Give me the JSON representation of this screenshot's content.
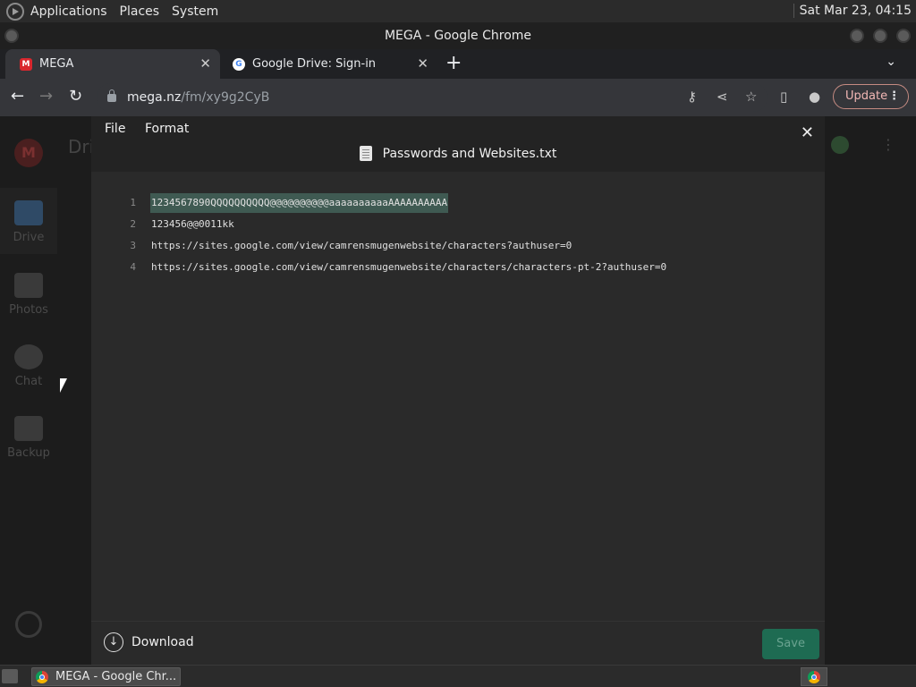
{
  "top_panel": {
    "menus": [
      "Applications",
      "Places",
      "System"
    ],
    "clock": "Sat Mar 23, 04:15"
  },
  "window": {
    "title": "MEGA - Google Chrome"
  },
  "tabs": [
    {
      "label": "MEGA",
      "icon": "mega-favicon",
      "active": true
    },
    {
      "label": "Google Drive: Sign-in",
      "icon": "google-favicon",
      "active": false
    }
  ],
  "toolbar": {
    "url_host": "mega.nz",
    "url_path": "/fm/xy9g2CyB",
    "update_label": "Update"
  },
  "mega_app": {
    "header_fragment": "Dri",
    "sidebar": [
      {
        "label": "Drive",
        "icon": "folder-icon"
      },
      {
        "label": "Photos",
        "icon": "photos-icon"
      },
      {
        "label": "Chat",
        "icon": "chat-icon"
      },
      {
        "label": "Backup",
        "icon": "backup-icon"
      }
    ]
  },
  "editor": {
    "menus": [
      "File",
      "Format"
    ],
    "filename": "Passwords and Websites.txt",
    "lines": [
      {
        "num": "1",
        "text": "1234567890QQQQQQQQQQ@@@@@@@@@@aaaaaaaaaaAAAAAAAAAA",
        "selected": true
      },
      {
        "num": "2",
        "text": "123456@@0011kk",
        "selected": false
      },
      {
        "num": "3",
        "text": "https://sites.google.com/view/camrensmugenwebsite/characters?authuser=0",
        "selected": false
      },
      {
        "num": "4",
        "text": "https://sites.google.com/view/camrensmugenwebsite/characters/characters-pt-2?authuser=0",
        "selected": false
      }
    ],
    "download_label": "Download",
    "save_label": "Save"
  },
  "taskbar": {
    "window_label": "MEGA - Google Chr..."
  },
  "colors": {
    "selection": "#3f5a52",
    "save_button": "#1e6b52",
    "update_border": "#c58b82"
  }
}
